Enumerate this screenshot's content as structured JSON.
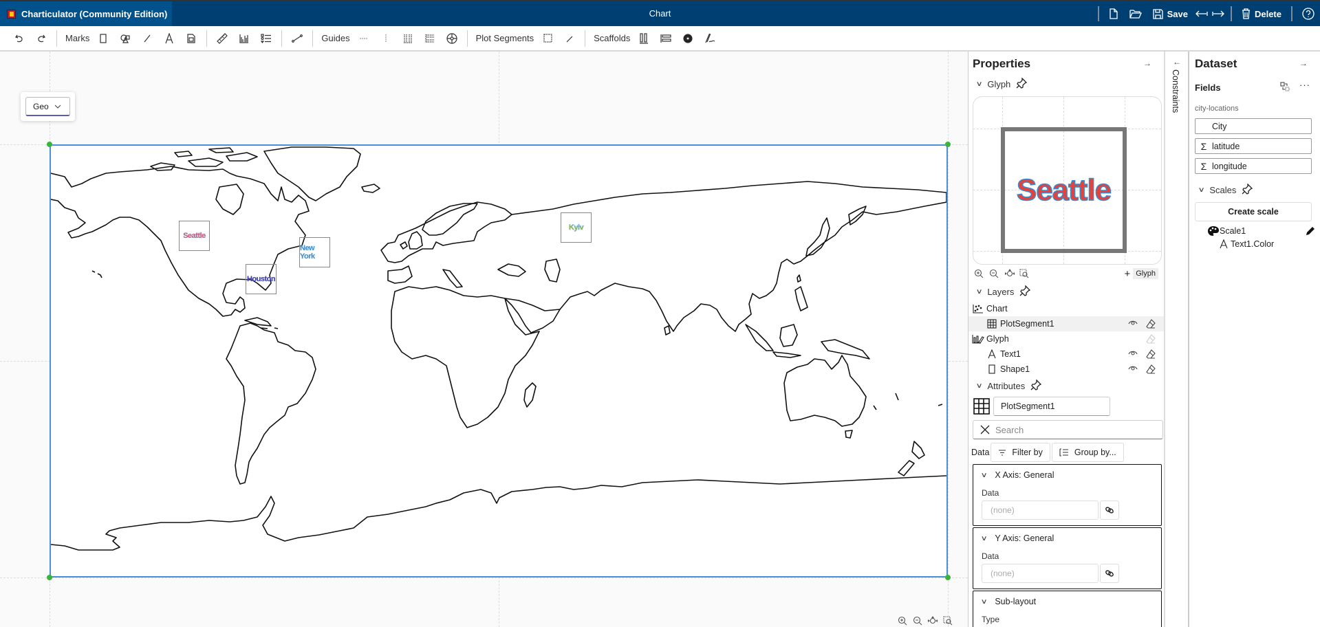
{
  "app": {
    "title": "Charticulator (Community Edition)",
    "document_title": "Chart"
  },
  "title_actions": [
    {
      "name": "new-button",
      "icon": "new-file-icon",
      "label": ""
    },
    {
      "name": "open-button",
      "icon": "folder-open-icon",
      "label": ""
    },
    {
      "name": "save-button",
      "icon": "save-icon",
      "label": "Save"
    },
    {
      "name": "undo-nav-button",
      "icon": "arrow-left-bar-icon",
      "label": ""
    },
    {
      "name": "redo-nav-button",
      "icon": "arrow-right-bar-icon",
      "label": ""
    },
    {
      "name": "delete-button",
      "icon": "trash-icon",
      "label": "Delete"
    },
    {
      "name": "help-button",
      "icon": "help-icon",
      "label": ""
    }
  ],
  "toolbar": {
    "marks_label": "Marks",
    "guides_label": "Guides",
    "plot_segments_label": "Plot Segments",
    "scaffolds_label": "Scaffolds"
  },
  "canvas": {
    "layout_select": "Geo",
    "cities": [
      {
        "name": "Seattle",
        "color": "#e0506a",
        "stroke": "#7a9fd0"
      },
      {
        "name": "New York",
        "color": "#3a8ccc",
        "stroke": "#7ab0e0"
      },
      {
        "name": "Houston",
        "color": "#3a3ab0",
        "stroke": "#7070d0"
      },
      {
        "name": "Kyiv",
        "color": "#9bc24a",
        "stroke": "#3a8ccc"
      }
    ]
  },
  "properties": {
    "title": "Properties",
    "glyph_section": "Glyph",
    "glyph_preview_text": "Seattle",
    "add_glyph_label": "Glyph",
    "layers_section": "Layers",
    "layers": [
      {
        "label": "Chart",
        "icon": "scatter-icon",
        "level": 0,
        "selected": false,
        "visible_toggle": false,
        "delete": false
      },
      {
        "label": "PlotSegment1",
        "icon": "grid-icon",
        "level": 1,
        "selected": true,
        "visible_toggle": true,
        "delete": true
      },
      {
        "label": "Glyph",
        "icon": "glyph-icon",
        "level": 0,
        "selected": false,
        "visible_toggle": false,
        "delete": "disabled"
      },
      {
        "label": "Text1",
        "icon": "text-icon",
        "level": 1,
        "selected": false,
        "visible_toggle": true,
        "delete": true
      },
      {
        "label": "Shape1",
        "icon": "rect-icon",
        "level": 1,
        "selected": false,
        "visible_toggle": true,
        "delete": true
      }
    ],
    "attributes_section": "Attributes",
    "attribute_name": "PlotSegment1",
    "search_placeholder": "Search",
    "data_label": "Data",
    "filter_by": "Filter by",
    "group_by": "Group by...",
    "x_axis": {
      "title": "X Axis: General",
      "data_label": "Data",
      "placeholder": "(none)"
    },
    "y_axis": {
      "title": "Y Axis: General",
      "data_label": "Data",
      "placeholder": "(none)"
    },
    "sub_layout": {
      "title": "Sub-layout",
      "type_label": "Type"
    }
  },
  "constraints": {
    "label": "Constraints"
  },
  "dataset": {
    "title": "Dataset",
    "fields_label": "Fields",
    "source_name": "city-locations",
    "fields": [
      {
        "name": "City",
        "type": "categorical",
        "symbol": ""
      },
      {
        "name": "latitude",
        "type": "numerical",
        "symbol": "Σ"
      },
      {
        "name": "longitude",
        "type": "numerical",
        "symbol": "Σ"
      }
    ],
    "scales_label": "Scales",
    "create_scale": "Create scale",
    "scales": [
      {
        "name": "Scale1",
        "mapping": "Text1.Color"
      }
    ]
  }
}
